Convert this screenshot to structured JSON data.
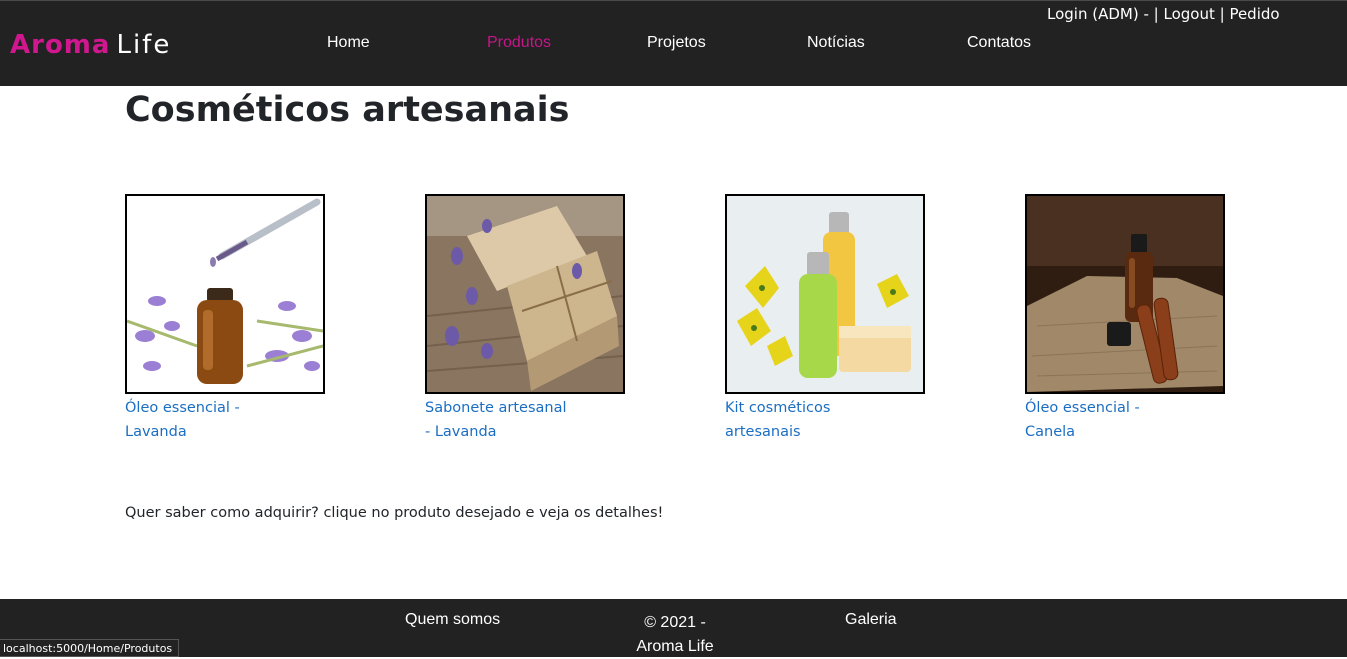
{
  "header": {
    "logo_part1": "Aroma",
    "logo_part2": "Life",
    "nav": [
      {
        "label": "Home"
      },
      {
        "label": "Produtos"
      },
      {
        "label": "Projetos"
      },
      {
        "label": "Notícias"
      },
      {
        "label": "Contatos"
      }
    ],
    "account": {
      "login": "Login (ADM)",
      "sep1": " - | ",
      "logout": "Logout",
      "sep2": " | ",
      "pedido": "Pedido"
    },
    "active_color": "#c7158b"
  },
  "main": {
    "title": "Cosméticos artesanais",
    "products": [
      {
        "name": "Óleo essencial - Lavanda",
        "image": "lavender-oil-bottle"
      },
      {
        "name": "Sabonete artesanal - Lavanda",
        "image": "lavender-soap-bars"
      },
      {
        "name": "Kit cosméticos artesanais",
        "image": "cosmetics-kit-bottles"
      },
      {
        "name": "Óleo essencial - Canela",
        "image": "cinnamon-oil-bottle"
      }
    ],
    "hint": "Quer saber como adquirir? clique no produto desejado e veja os detalhes!"
  },
  "footer": {
    "about": "Quem somos",
    "copyright": "© 2021 - Aroma Life",
    "gallery": "Galeria"
  },
  "status_url": "localhost:5000/Home/Produtos",
  "colors": {
    "bar_bg": "#222222",
    "brand": "#d1178f",
    "link": "#1b6ec2"
  }
}
